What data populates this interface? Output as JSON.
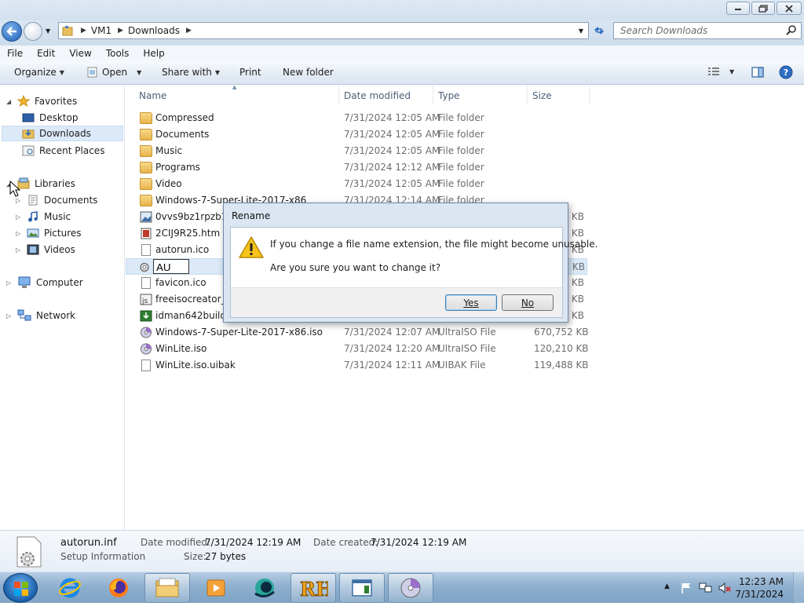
{
  "address": {
    "crumbs": [
      "VM1",
      "Downloads"
    ]
  },
  "search": {
    "placeholder": "Search Downloads"
  },
  "menu": [
    "File",
    "Edit",
    "View",
    "Tools",
    "Help"
  ],
  "toolbar": {
    "organize": "Organize",
    "open": "Open",
    "share": "Share with",
    "print": "Print",
    "new_folder": "New folder"
  },
  "sidebar": {
    "favorites": "Favorites",
    "desktop": "Desktop",
    "downloads": "Downloads",
    "recent": "Recent Places",
    "libraries": "Libraries",
    "documents": "Documents",
    "music": "Music",
    "pictures": "Pictures",
    "videos": "Videos",
    "computer": "Computer",
    "network": "Network"
  },
  "columns": {
    "name": "Name",
    "date": "Date modified",
    "type": "Type",
    "size": "Size"
  },
  "files": [
    {
      "name": "Compressed",
      "date": "7/31/2024 12:05 AM",
      "type": "File folder",
      "size": ""
    },
    {
      "name": "Documents",
      "date": "7/31/2024 12:05 AM",
      "type": "File folder",
      "size": ""
    },
    {
      "name": "Music",
      "date": "7/31/2024 12:05 AM",
      "type": "File folder",
      "size": ""
    },
    {
      "name": "Programs",
      "date": "7/31/2024 12:12 AM",
      "type": "File folder",
      "size": ""
    },
    {
      "name": "Video",
      "date": "7/31/2024 12:05 AM",
      "type": "File folder",
      "size": ""
    },
    {
      "name": "Windows-7-Super-Lite-2017-x86",
      "date": "7/31/2024 12:14 AM",
      "type": "File folder",
      "size": ""
    },
    {
      "name": "0vvs9bz1rpzb1.jp",
      "date": "",
      "type": "",
      "size": "5 KB"
    },
    {
      "name": "2CIJ9R25.htm",
      "date": "",
      "type": "",
      "size": "5 KB"
    },
    {
      "name": "autorun.ico",
      "date": "",
      "type": "",
      "size": "3 KB"
    },
    {
      "name": "AU",
      "date": "",
      "type": "",
      "size": "1 KB"
    },
    {
      "name": "favicon.ico",
      "date": "",
      "type": "",
      "size": "5 KB"
    },
    {
      "name": "freeisocreator_se",
      "date": "",
      "type": "",
      "size": "5 KB"
    },
    {
      "name": "idman642build1",
      "date": "",
      "type": "",
      "size": "9 KB"
    },
    {
      "name": "Windows-7-Super-Lite-2017-x86.iso",
      "date": "7/31/2024 12:07 AM",
      "type": "UltraISO File",
      "size": "670,752 KB"
    },
    {
      "name": "WinLite.iso",
      "date": "7/31/2024 12:20 AM",
      "type": "UltraISO File",
      "size": "120,210 KB"
    },
    {
      "name": "WinLite.iso.uibak",
      "date": "7/31/2024 12:11 AM",
      "type": "UIBAK File",
      "size": "119,488 KB"
    }
  ],
  "dialog": {
    "title": "Rename",
    "message1": "If you change a file name extension, the file might become unusable.",
    "message2": "Are you sure you want to change it?",
    "yes": "Yes",
    "no": "No"
  },
  "details": {
    "filename": "autorun.inf",
    "filetype": "Setup Information",
    "modified_label": "Date modified:",
    "modified_value": "7/31/2024 12:19 AM",
    "created_label": "Date created:",
    "created_value": "7/31/2024 12:19 AM",
    "size_label": "Size:",
    "size_value": "27 bytes"
  },
  "clock": {
    "time": "12:23 AM",
    "date": "7/31/2024"
  }
}
